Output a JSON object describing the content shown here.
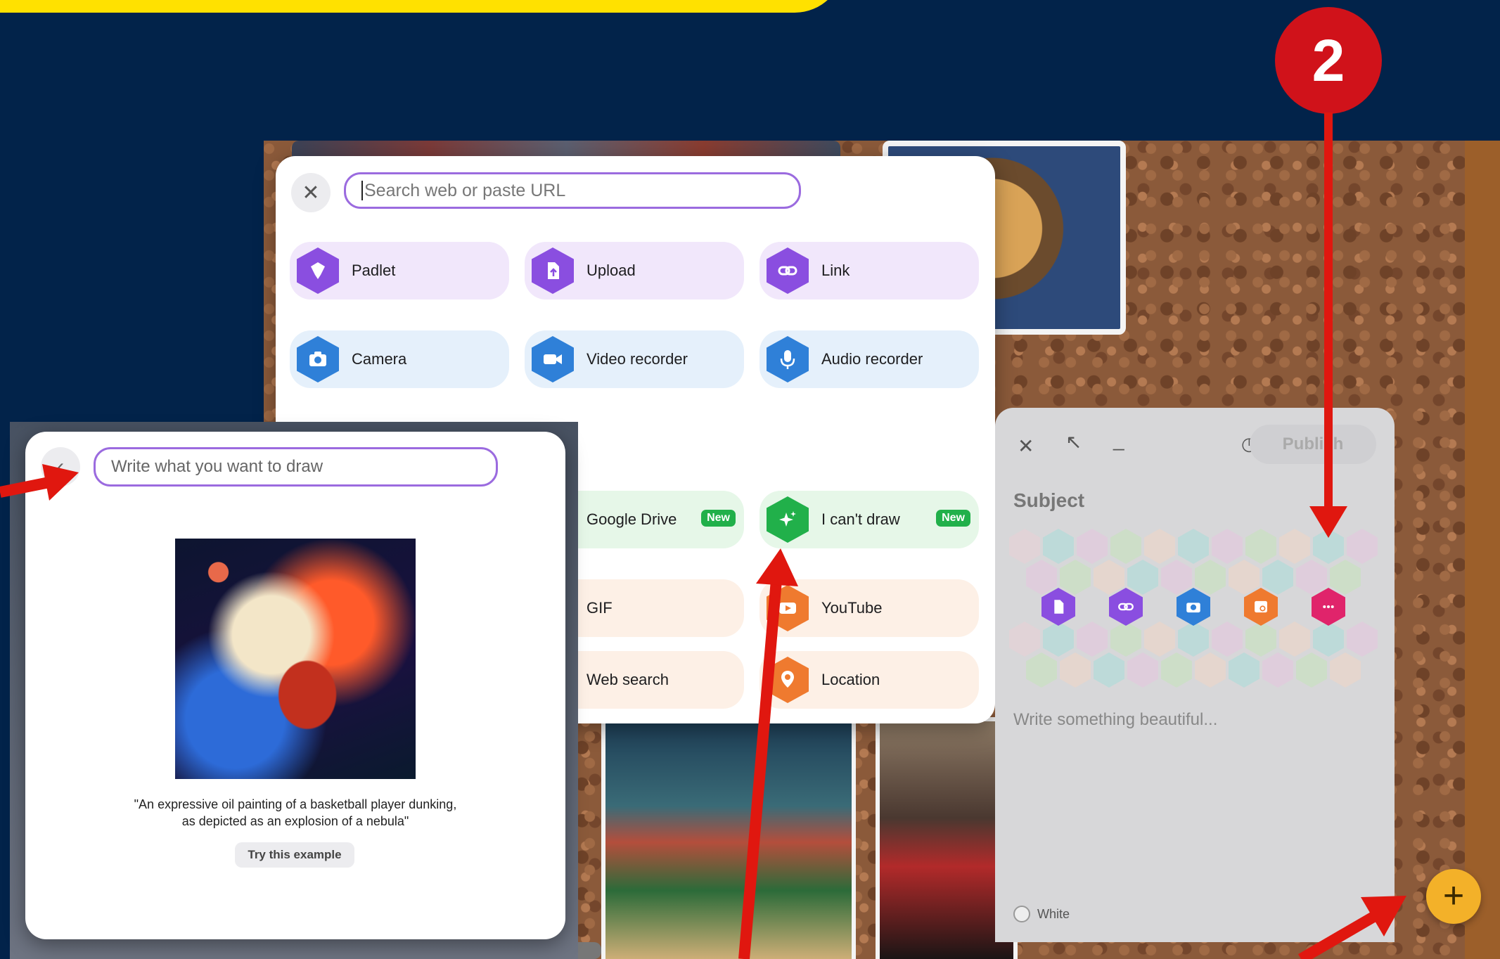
{
  "step_number": "2",
  "add_content_panel": {
    "search_placeholder": "Search web or paste URL",
    "options": [
      {
        "label": "Padlet",
        "icon": "padlet-icon"
      },
      {
        "label": "Upload",
        "icon": "upload-icon"
      },
      {
        "label": "Link",
        "icon": "link-icon"
      },
      {
        "label": "Camera",
        "icon": "camera-icon"
      },
      {
        "label": "Video recorder",
        "icon": "video-recorder-icon"
      },
      {
        "label": "Audio recorder",
        "icon": "microphone-icon"
      },
      {
        "label": "Google Drive",
        "icon": "google-drive-icon",
        "badge": "New"
      },
      {
        "label": "I can't draw",
        "icon": "sparkle-icon",
        "badge": "New"
      },
      {
        "label": "GIF",
        "icon": "gif-icon"
      },
      {
        "label": "YouTube",
        "icon": "youtube-icon"
      },
      {
        "label": "Web search",
        "icon": "web-search-icon"
      },
      {
        "label": "Location",
        "icon": "location-icon"
      }
    ]
  },
  "draw_panel": {
    "input_placeholder": "Write what you want to draw",
    "caption": "\"An expressive oil painting of a basketball player dunking, as depicted as an explosion of a nebula\"",
    "try_button": "Try this example"
  },
  "post_panel": {
    "publish_label": "Publish",
    "subject_placeholder": "Subject",
    "body_placeholder": "Write something beautiful...",
    "color_option": "White"
  },
  "colors": {
    "background": "#02234a",
    "accent_purple": "#8a4ee0",
    "accent_blue": "#2f80d8",
    "accent_green": "#21b04a",
    "accent_orange": "#ef7a2f",
    "annotation_red": "#e0170f",
    "fab_yellow": "#f3b129"
  }
}
